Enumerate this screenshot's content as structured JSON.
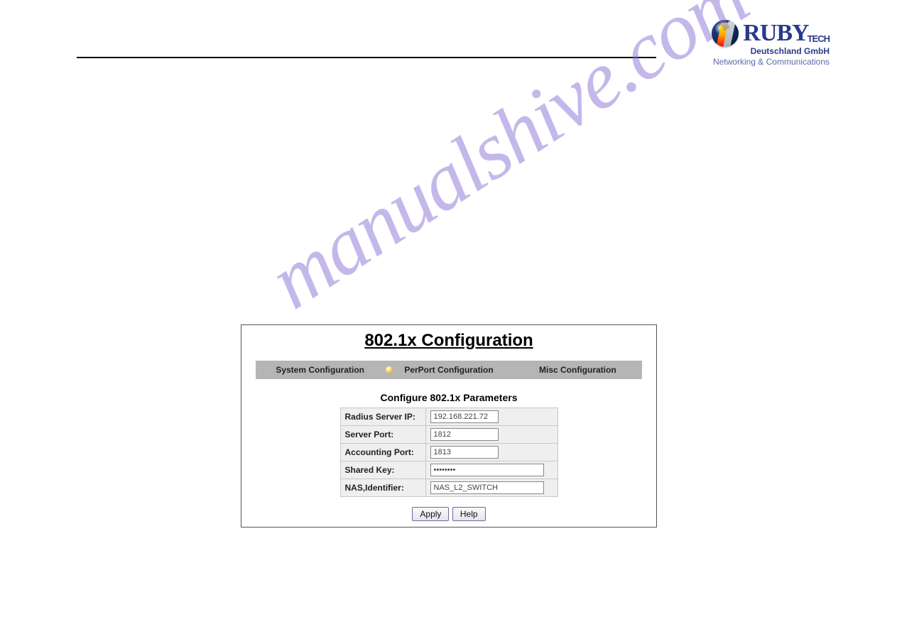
{
  "logo": {
    "brand_main": "RUBY",
    "brand_suffix": "TECH",
    "line1": "Deutschland GmbH",
    "line2": "Networking & Communications"
  },
  "watermark": "manualshive.com",
  "panel": {
    "title": "802.1x Configuration",
    "tabs": {
      "system": "System Configuration",
      "perport": "PerPort Configuration",
      "misc": "Misc Configuration"
    },
    "section_heading": "Configure 802.1x Parameters",
    "fields": {
      "radius_ip": {
        "label": "Radius Server IP:",
        "value": "192.168.221.72"
      },
      "server_port": {
        "label": "Server Port:",
        "value": "1812"
      },
      "acct_port": {
        "label": "Accounting Port:",
        "value": "1813"
      },
      "shared_key": {
        "label": "Shared Key:",
        "value": "••••••••"
      },
      "nas_id": {
        "label": "NAS,Identifier:",
        "value": "NAS_L2_SWITCH"
      }
    },
    "buttons": {
      "apply": "Apply",
      "help": "Help"
    }
  }
}
